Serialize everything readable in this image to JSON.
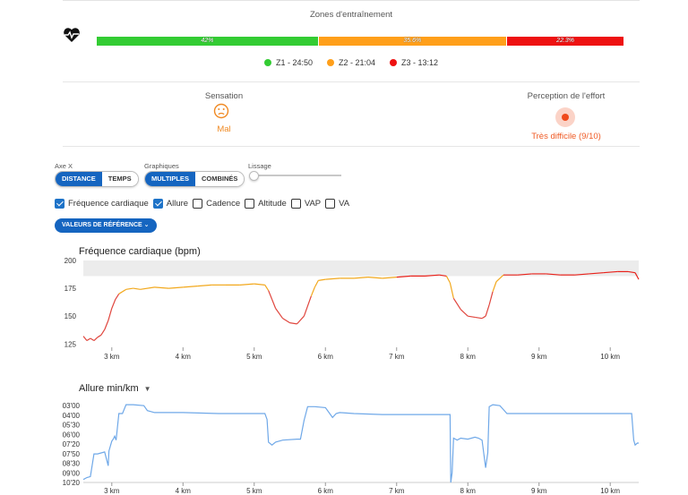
{
  "zones": {
    "title": "Zones d'entraînement",
    "segments": [
      {
        "label": "42%",
        "pct": 42.0,
        "color": "#33cc33"
      },
      {
        "label": "35.6%",
        "pct": 35.6,
        "color": "#ff9f1a"
      },
      {
        "label": "22.3%",
        "pct": 22.3,
        "color": "#ee1111"
      }
    ],
    "legend": [
      {
        "label": "Z1 - 24:50",
        "color": "#33cc33"
      },
      {
        "label": "Z2 - 21:04",
        "color": "#ff9f1a"
      },
      {
        "label": "Z3 - 13:12",
        "color": "#ee1111"
      }
    ]
  },
  "sensation": {
    "label": "Sensation",
    "value": "Mal"
  },
  "effort": {
    "label": "Perception de l'effort",
    "value": "Très difficile (9/10)"
  },
  "controls": {
    "axis_x": {
      "label": "Axe X",
      "options": [
        "DISTANCE",
        "TEMPS"
      ],
      "selected": "DISTANCE"
    },
    "graphs": {
      "label": "Graphiques",
      "options": [
        "MULTIPLES",
        "COMBINÉS"
      ],
      "selected": "MULTIPLES"
    },
    "smoothing": {
      "label": "Lissage",
      "value": 0
    },
    "checkboxes": [
      {
        "label": "Fréquence cardiaque",
        "checked": true
      },
      {
        "label": "Allure",
        "checked": true
      },
      {
        "label": "Cadence",
        "checked": false
      },
      {
        "label": "Altitude",
        "checked": false
      },
      {
        "label": "VAP",
        "checked": false
      },
      {
        "label": "VA",
        "checked": false
      }
    ],
    "reference_button": "VALEURS DE RÉFÉRENCE"
  },
  "chart_data": [
    {
      "type": "line",
      "title": "Fréquence cardiaque (bpm)",
      "xlabel": "",
      "ylabel": "",
      "x_ticks": [
        "3 km",
        "4 km",
        "5 km",
        "6 km",
        "7 km",
        "8 km",
        "9 km",
        "10 km"
      ],
      "y_ticks": [
        "200",
        "175",
        "150",
        "125"
      ],
      "xlim": [
        2.6,
        10.4
      ],
      "ylim": [
        122,
        200
      ],
      "zone_band": [
        186,
        200
      ],
      "series": [
        {
          "x": [
            2.6,
            2.65,
            2.7,
            2.75,
            2.8,
            2.85,
            2.9,
            2.95,
            3.0,
            3.05,
            3.1,
            3.15,
            3.2,
            3.3,
            3.4,
            3.6,
            3.8,
            4.0,
            4.2,
            4.4,
            4.6,
            4.8,
            5.0,
            5.15,
            5.2,
            5.25,
            5.3,
            5.4,
            5.5,
            5.6,
            5.7,
            5.8,
            5.85,
            5.9,
            6.0,
            6.2,
            6.4,
            6.6,
            6.8,
            7.0,
            7.2,
            7.4,
            7.6,
            7.7,
            7.75,
            7.8,
            7.9,
            8.0,
            8.1,
            8.2,
            8.25,
            8.3,
            8.35,
            8.4,
            8.5,
            8.7,
            8.9,
            9.1,
            9.3,
            9.5,
            9.7,
            9.9,
            10.1,
            10.25,
            10.35,
            10.4
          ],
          "y": [
            132,
            128,
            130,
            128,
            131,
            133,
            138,
            146,
            157,
            165,
            170,
            172,
            174,
            175,
            174,
            176,
            175,
            176,
            177,
            178,
            178,
            178,
            179,
            178,
            173,
            165,
            157,
            148,
            144,
            143,
            150,
            168,
            176,
            182,
            183,
            184,
            184,
            185,
            184,
            185,
            186,
            186,
            187,
            186,
            180,
            166,
            156,
            150,
            149,
            148,
            150,
            160,
            172,
            181,
            187,
            187,
            188,
            188,
            187,
            187,
            188,
            189,
            190,
            190,
            189,
            183
          ]
        }
      ]
    },
    {
      "type": "line",
      "title": "Allure",
      "unit_selector": "min/km",
      "xlabel": "",
      "ylabel": "",
      "x_ticks": [
        "3 km",
        "4 km",
        "5 km",
        "6 km",
        "7 km",
        "8 km",
        "9 km",
        "10 km"
      ],
      "y_ticks": [
        "03'00",
        "04'00",
        "05'30",
        "06'00",
        "07'20",
        "07'50",
        "08'30",
        "09'00",
        "10'20"
      ],
      "xlim": [
        2.6,
        10.4
      ],
      "color": "#6fa8e8",
      "series": [
        {
          "x": [
            2.6,
            2.65,
            2.7,
            2.75,
            2.8,
            2.85,
            2.9,
            2.95,
            2.96,
            3.0,
            3.02,
            3.04,
            3.06,
            3.1,
            3.15,
            3.2,
            3.3,
            3.45,
            3.5,
            3.55,
            3.6,
            3.8,
            4.0,
            4.5,
            5.0,
            5.15,
            5.18,
            5.2,
            5.25,
            5.3,
            5.4,
            5.6,
            5.65,
            5.7,
            5.75,
            5.8,
            5.85,
            6.0,
            6.1,
            6.15,
            6.2,
            6.4,
            6.8,
            7.2,
            7.5,
            7.7,
            7.75,
            7.76,
            7.78,
            7.8,
            7.85,
            7.9,
            8.0,
            8.1,
            8.15,
            8.2,
            8.25,
            8.28,
            8.3,
            8.35,
            8.45,
            8.5,
            8.55,
            8.6,
            8.7,
            9.0,
            9.5,
            10.0,
            10.3,
            10.33,
            10.35,
            10.38,
            10.4
          ],
          "y": [
            10.2,
            10.0,
            9.9,
            7.6,
            7.6,
            7.5,
            7.4,
            8.8,
            7.3,
            6.3,
            6.1,
            5.8,
            6.2,
            3.5,
            3.5,
            2.6,
            2.6,
            2.7,
            3.2,
            3.3,
            3.4,
            3.4,
            3.4,
            3.5,
            3.5,
            3.5,
            4.1,
            6.4,
            6.7,
            6.4,
            6.2,
            6.1,
            6.1,
            4.2,
            2.8,
            2.8,
            2.8,
            2.9,
            3.9,
            3.5,
            3.4,
            3.5,
            3.6,
            3.6,
            3.6,
            3.6,
            3.6,
            10.5,
            9.5,
            6.0,
            6.2,
            6.0,
            6.1,
            5.9,
            6.0,
            6.2,
            9.0,
            7.5,
            2.8,
            2.6,
            2.7,
            3.1,
            3.5,
            3.5,
            3.5,
            3.5,
            3.5,
            3.5,
            3.5,
            6.2,
            6.7,
            6.5,
            6.5
          ]
        }
      ]
    }
  ]
}
